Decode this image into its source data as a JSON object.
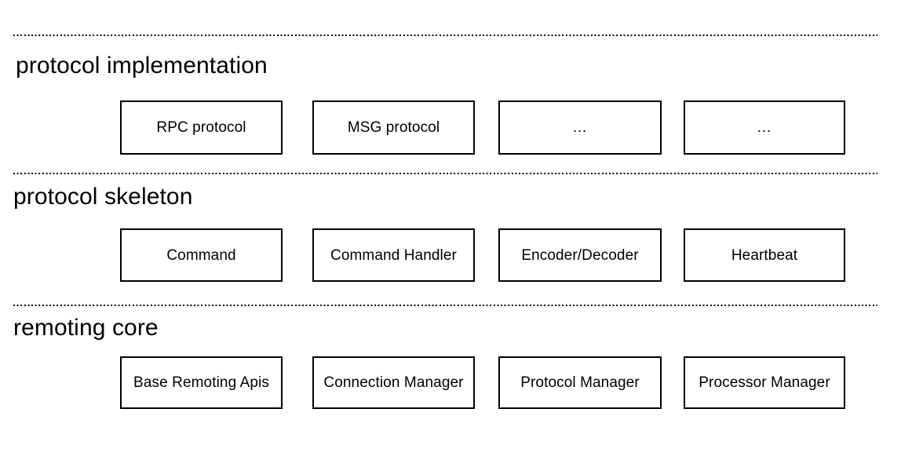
{
  "diagram": {
    "title": "",
    "colors": {
      "background": "#ffffff",
      "stroke": "#000000",
      "text": "#000000"
    },
    "sections": [
      {
        "id": "protocol-implementation",
        "label": "protocol implementation",
        "boxes": [
          {
            "label": "RPC protocol"
          },
          {
            "label": "MSG protocol"
          },
          {
            "label": "…"
          },
          {
            "label": "…"
          }
        ]
      },
      {
        "id": "protocol-skeleton",
        "label": "protocol skeleton",
        "boxes": [
          {
            "label": "Command"
          },
          {
            "label": "Command Handler"
          },
          {
            "label": "Encoder/Decoder"
          },
          {
            "label": "Heartbeat"
          }
        ]
      },
      {
        "id": "remoting-core",
        "label": "remoting core",
        "boxes": [
          {
            "label": "Base Remoting Apis"
          },
          {
            "label": "Connection Manager"
          },
          {
            "label": "Protocol Manager"
          },
          {
            "label": "Processor Manager"
          }
        ]
      }
    ]
  }
}
